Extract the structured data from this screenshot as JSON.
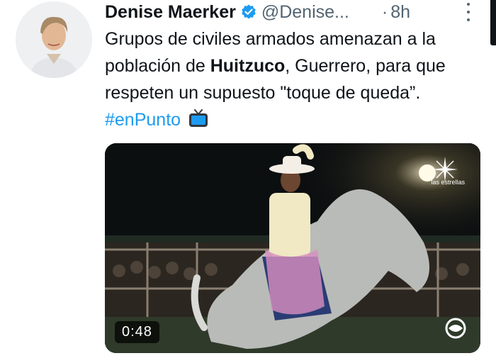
{
  "author": {
    "name": "Denise Maerker",
    "handle": "@Denise...",
    "timestamp_separator": "·",
    "timestamp": "8h",
    "verified": true,
    "avatar_icon": "person-avatar"
  },
  "tweet": {
    "text_before": "Grupos de civiles armados amenazan a la población de ",
    "bold_word": "Huitzuco",
    "text_after": ", Guerrero, para que respeten un supuesto \"toque de queda”. ",
    "hashtag": "#enPunto",
    "emoji_icon": "tv-icon"
  },
  "media": {
    "type": "video",
    "duration": "0:48",
    "watermark_label": "las estrellas"
  },
  "colors": {
    "accent": "#1d9bf0",
    "text": "#0f1419",
    "secondary_text": "#536471"
  }
}
